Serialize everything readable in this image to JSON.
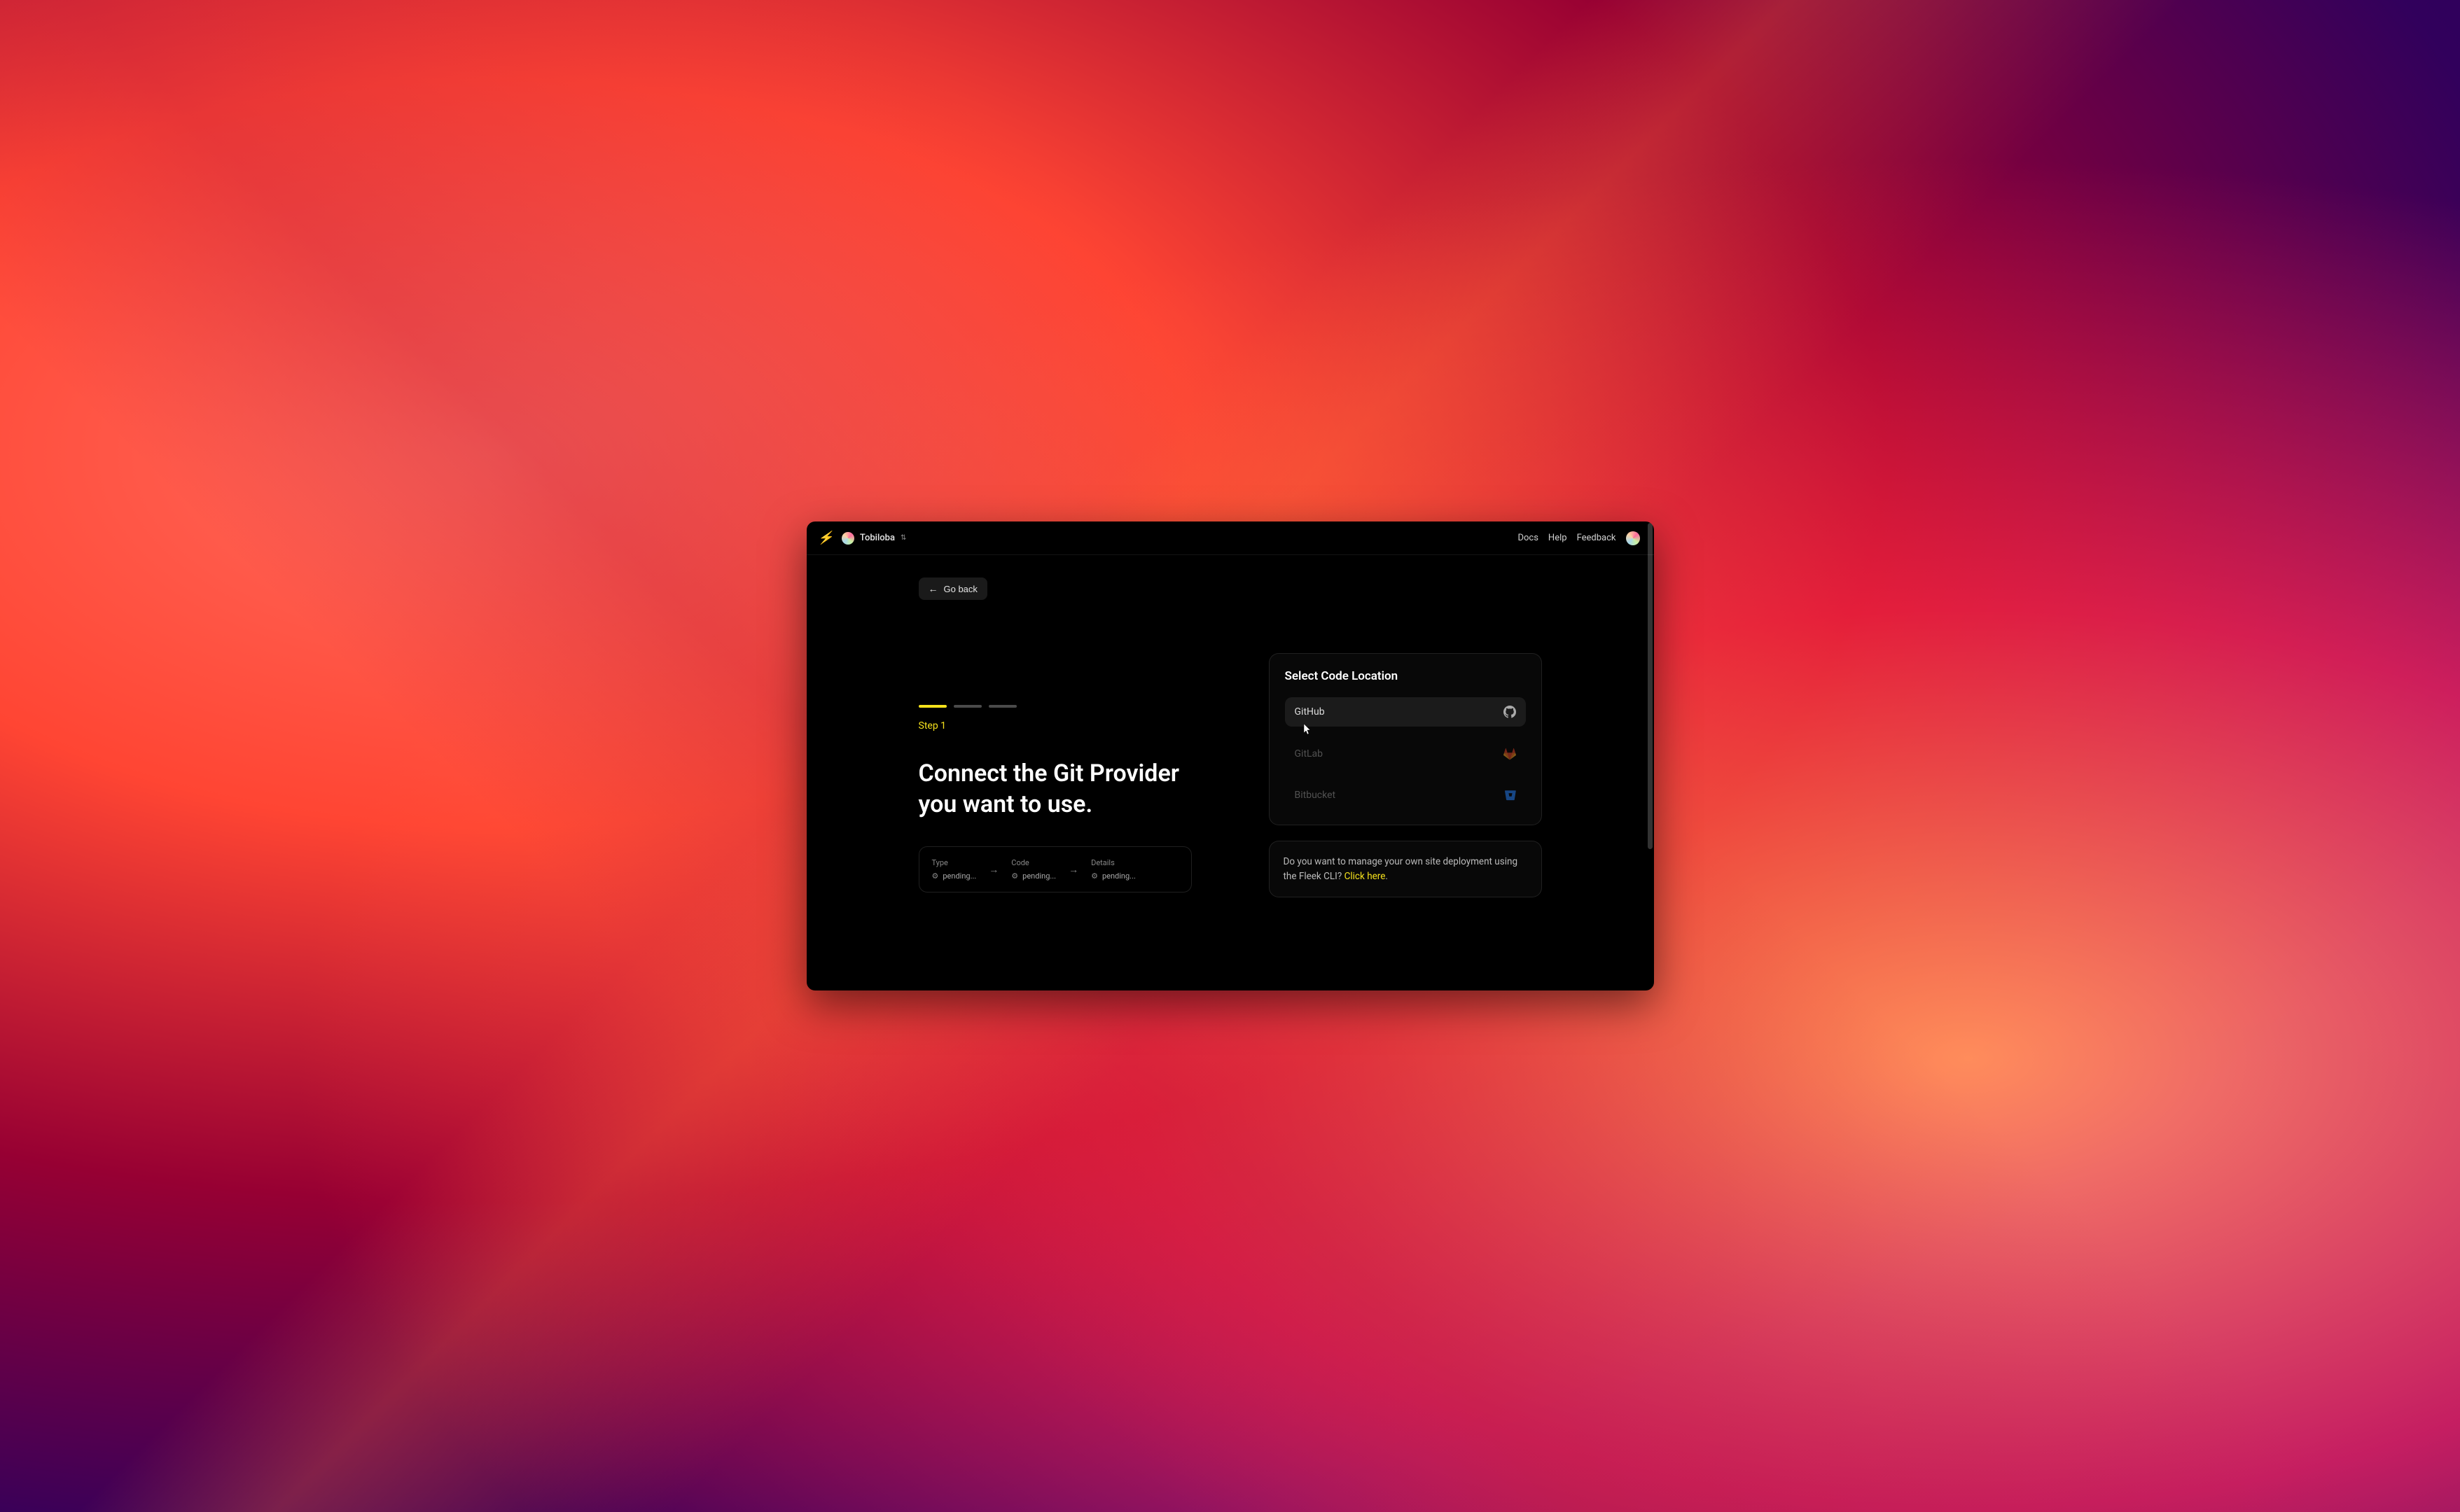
{
  "header": {
    "user_name": "Tobiloba",
    "nav": {
      "docs": "Docs",
      "help": "Help",
      "feedback": "Feedback"
    }
  },
  "go_back": "Go back",
  "step": {
    "label": "Step 1",
    "current": 1,
    "total": 3
  },
  "heading": "Connect the Git Provider you want to use.",
  "pending": {
    "items": [
      {
        "label": "Type",
        "value": "pending..."
      },
      {
        "label": "Code",
        "value": "pending..."
      },
      {
        "label": "Details",
        "value": "pending..."
      }
    ]
  },
  "panel": {
    "title": "Select Code Location",
    "providers": [
      {
        "name": "GitHub",
        "icon": "github",
        "selected": true
      },
      {
        "name": "GitLab",
        "icon": "gitlab",
        "selected": false
      },
      {
        "name": "Bitbucket",
        "icon": "bitbucket",
        "selected": false
      }
    ]
  },
  "cli": {
    "text_before": "Do you want to manage your own site deployment using the Fleek CLI? ",
    "link": "Click here",
    "text_after": "."
  }
}
